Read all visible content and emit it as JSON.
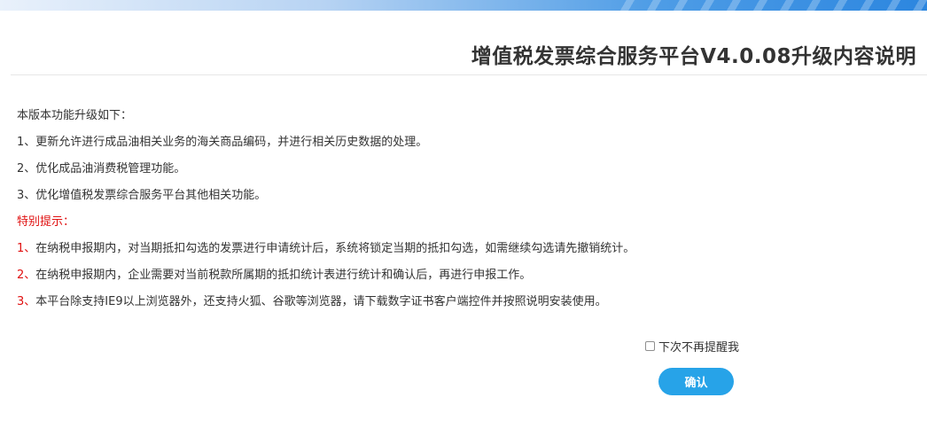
{
  "header": {
    "title": "增值税发票综合服务平台V4.0.08升级内容说明"
  },
  "content": {
    "intro": "本版本功能升级如下：",
    "upgrades": [
      "1、更新允许进行成品油相关业务的海关商品编码，并进行相关历史数据的处理。",
      "2、优化成品油消费税管理功能。",
      "3、优化增值税发票综合服务平台其他相关功能。"
    ],
    "notice_heading": "特别提示：",
    "notices": [
      {
        "num": "1、",
        "text": "在纳税申报期内，对当期抵扣勾选的发票进行申请统计后，系统将锁定当期的抵扣勾选，如需继续勾选请先撤销统计。"
      },
      {
        "num": "2、",
        "text": "在纳税申报期内，企业需要对当前税款所属期的抵扣统计表进行统计和确认后，再进行申报工作。"
      },
      {
        "num": "3、",
        "text": "本平台除支持IE9以上浏览器外，还支持火狐、谷歌等浏览器，请下载数字证书客户端控件并按照说明安装使用。"
      }
    ]
  },
  "footer": {
    "reminder_label": "下次不再提醒我",
    "reminder_checked": false,
    "confirm_label": "确认"
  },
  "colors": {
    "accent": "#27a3e8",
    "notice": "#e01010",
    "text": "#333333"
  }
}
